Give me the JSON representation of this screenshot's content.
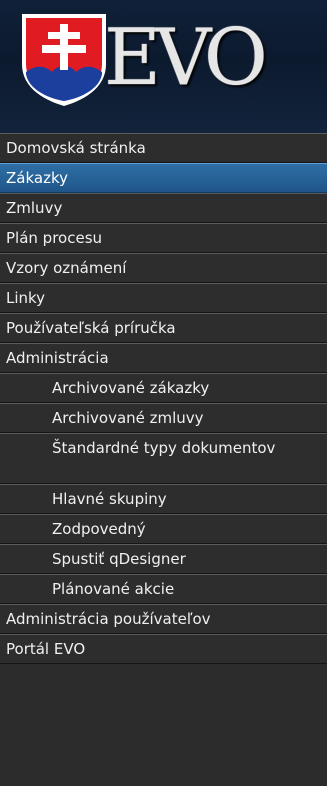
{
  "header": {
    "brand": "EVO",
    "logo_icon": "slovak-coat-of-arms-icon"
  },
  "colors": {
    "background": "#2d2d2d",
    "active": "#2e6fa6",
    "header": "#0f2038"
  },
  "menu": {
    "items": [
      {
        "label": "Domovská stránka",
        "active": false
      },
      {
        "label": "Zákazky",
        "active": true
      },
      {
        "label": "Zmluvy",
        "active": false
      },
      {
        "label": "Plán procesu",
        "active": false
      },
      {
        "label": "Vzory oznámení",
        "active": false
      },
      {
        "label": "Linky",
        "active": false
      },
      {
        "label": "Používateľská príručka",
        "active": false
      },
      {
        "label": "Administrácia",
        "active": false
      }
    ],
    "sub_items": [
      {
        "label": "Archivované zákazky"
      },
      {
        "label": "Archivované zmluvy"
      },
      {
        "label": "Štandardné typy dokumentov"
      },
      {
        "label": "Hlavné skupiny"
      },
      {
        "label": "Zodpovedný"
      },
      {
        "label": "Spustiť qDesigner"
      },
      {
        "label": "Plánované akcie"
      }
    ],
    "bottom_items": [
      {
        "label": "Administrácia používateľov"
      },
      {
        "label": "Portál EVO"
      }
    ]
  }
}
